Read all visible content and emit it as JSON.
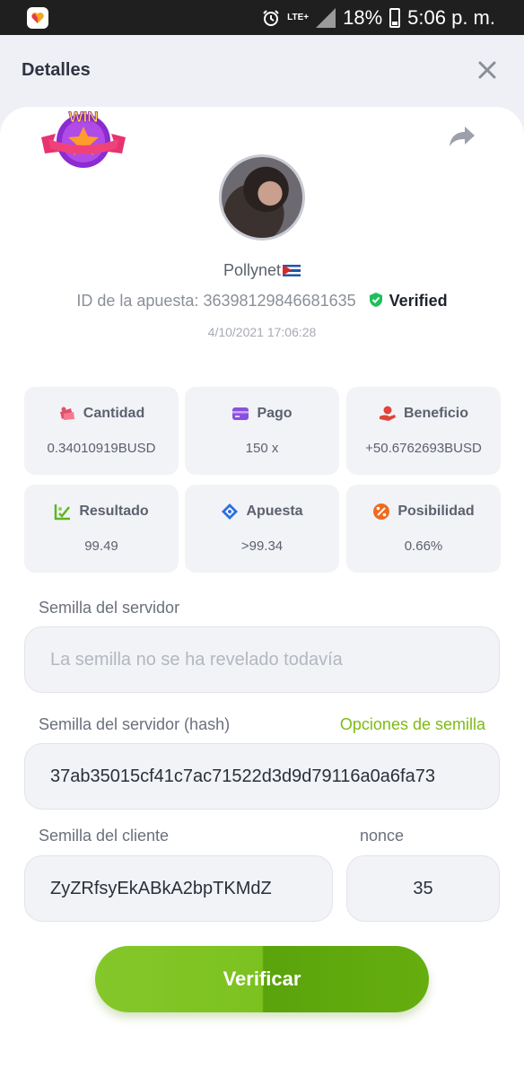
{
  "status_bar": {
    "network": "LTE+",
    "battery": "18%",
    "time": "5:06 p. m."
  },
  "header": {
    "title": "Detalles"
  },
  "bet": {
    "win_badge": "WIN",
    "username": "Pollynet",
    "id_label": "ID de la apuesta:",
    "id_value": "36398129846681635",
    "verified": "Verified",
    "date": "4/10/2021 17:06:28"
  },
  "stats": [
    {
      "label": "Cantidad",
      "value": "0.34010919BUSD",
      "icon": "money-icon",
      "color": "#e0506a"
    },
    {
      "label": "Pago",
      "value": "150 x",
      "icon": "card-icon",
      "color": "#8a4fe0"
    },
    {
      "label": "Beneficio",
      "value": "+50.6762693BUSD",
      "icon": "hand-coin-icon",
      "color": "#e0443a"
    },
    {
      "label": "Resultado",
      "value": "99.49",
      "icon": "chart-check-icon",
      "color": "#5fb520"
    },
    {
      "label": "Apuesta",
      "value": ">99.34",
      "icon": "target-diamond-icon",
      "color": "#2a6fe0"
    },
    {
      "label": "Posibilidad",
      "value": "0.66%",
      "icon": "percent-icon",
      "color": "#f06a1f"
    }
  ],
  "seeds": {
    "server_seed_label": "Semilla del servidor",
    "server_seed_placeholder": "La semilla no se ha revelado todavía",
    "server_hash_label": "Semilla del servidor (hash)",
    "seed_options_link": "Opciones de semilla",
    "server_hash_value": "37ab35015cf41c7ac71522d3d9d79116a0a6fa73",
    "client_seed_label": "Semilla del cliente",
    "client_seed_value": "ZyZRfsyEkABkA2bpTKMdZ",
    "nonce_label": "nonce",
    "nonce_value": "35"
  },
  "actions": {
    "verify_label": "Verificar"
  }
}
